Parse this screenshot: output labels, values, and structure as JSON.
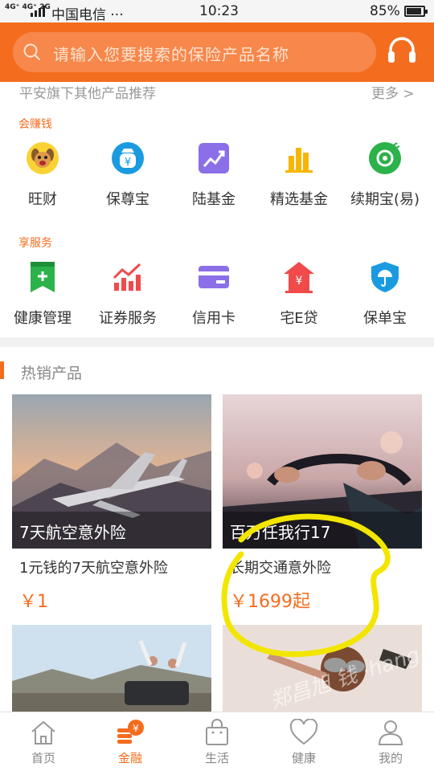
{
  "status": {
    "network": "4G⁺ 4G⁺ 2G",
    "carrier": "中国电信 ···",
    "time": "10:23",
    "battery": "85%"
  },
  "search": {
    "placeholder": "请输入您要搜索的保险产品名称"
  },
  "recommend": {
    "title": "平安旗下其他产品推荐",
    "more": "更多 >",
    "group1": {
      "label": "会赚钱",
      "items": [
        {
          "label": "旺财",
          "icon": "dog-icon"
        },
        {
          "label": "保尊宝",
          "icon": "yen-bag-icon"
        },
        {
          "label": "陆基金",
          "icon": "trend-chart-icon"
        },
        {
          "label": "精选基金",
          "icon": "bar-chart-icon"
        },
        {
          "label": "续期宝(易)",
          "icon": "renewal-icon"
        }
      ]
    },
    "group2": {
      "label": "享服务",
      "items": [
        {
          "label": "健康管理",
          "icon": "health-bookmark-icon"
        },
        {
          "label": "证券服务",
          "icon": "stock-chart-icon"
        },
        {
          "label": "信用卡",
          "icon": "credit-card-icon"
        },
        {
          "label": "宅E贷",
          "icon": "house-yen-icon"
        },
        {
          "label": "保单宝",
          "icon": "shield-umbrella-icon"
        }
      ]
    }
  },
  "hot": {
    "title": "热销产品",
    "products": [
      {
        "caption": "7天航空意外险",
        "title": "1元钱的7天航空意外险",
        "price": "￥1"
      },
      {
        "caption": "百万任我行17",
        "title": "长期交通意外险",
        "price": "￥1699起"
      }
    ]
  },
  "tabs": [
    {
      "label": "首页"
    },
    {
      "label": "金融"
    },
    {
      "label": "生活"
    },
    {
      "label": "健康"
    },
    {
      "label": "我的"
    }
  ],
  "watermark": "郑昌旭 钱 ·hang.org",
  "colors": {
    "accent": "#f46d1f",
    "header": "#f46d1f",
    "annotation": "#f2e600"
  }
}
